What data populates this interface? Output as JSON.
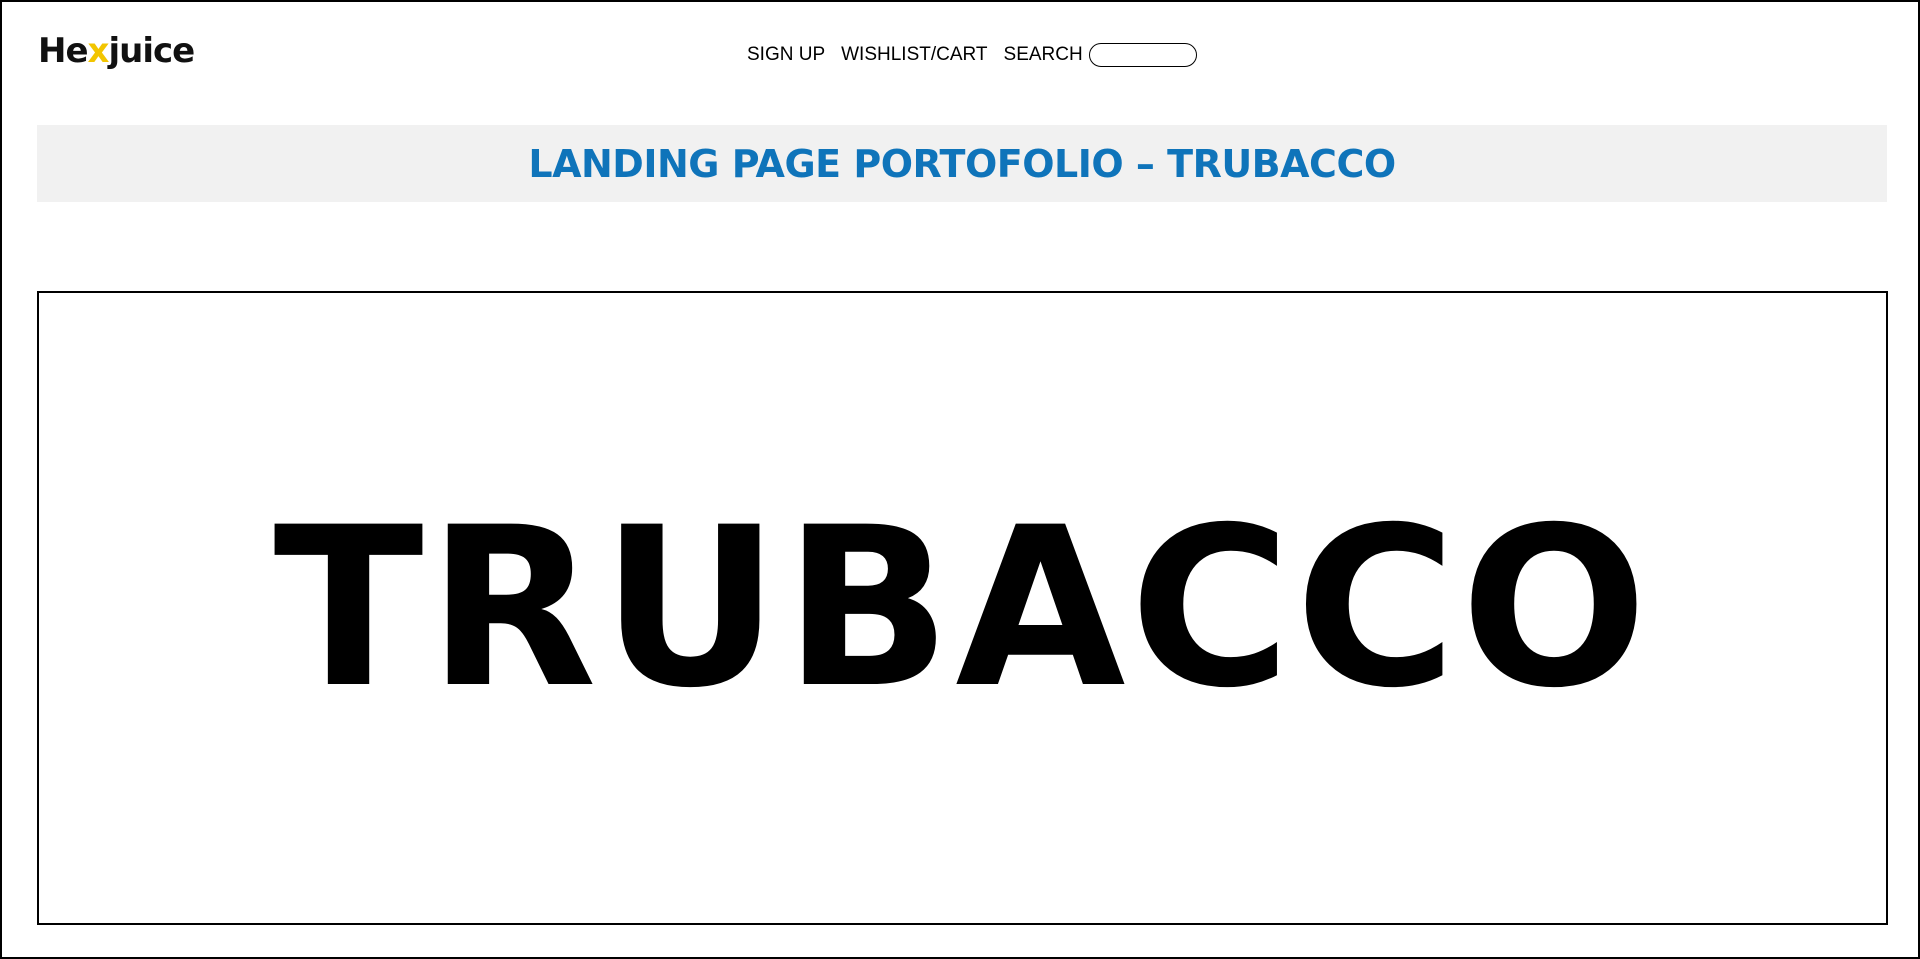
{
  "header": {
    "logo": {
      "prefix": "He",
      "accent_letter": "x",
      "suffix": "juice",
      "accent_color": "#f2c500"
    },
    "nav": {
      "signup_label": "SIGN UP",
      "wishlist_label": "WISHLIST/CART",
      "search_label": "SEARCH",
      "search_value": "",
      "search_placeholder": ""
    }
  },
  "banner": {
    "title": "LANDING PAGE PORTOFOLIO – TRUBACCO",
    "title_color": "#0f74ba",
    "background": "#f1f1f1"
  },
  "hero": {
    "word": "TRUBACCO"
  }
}
